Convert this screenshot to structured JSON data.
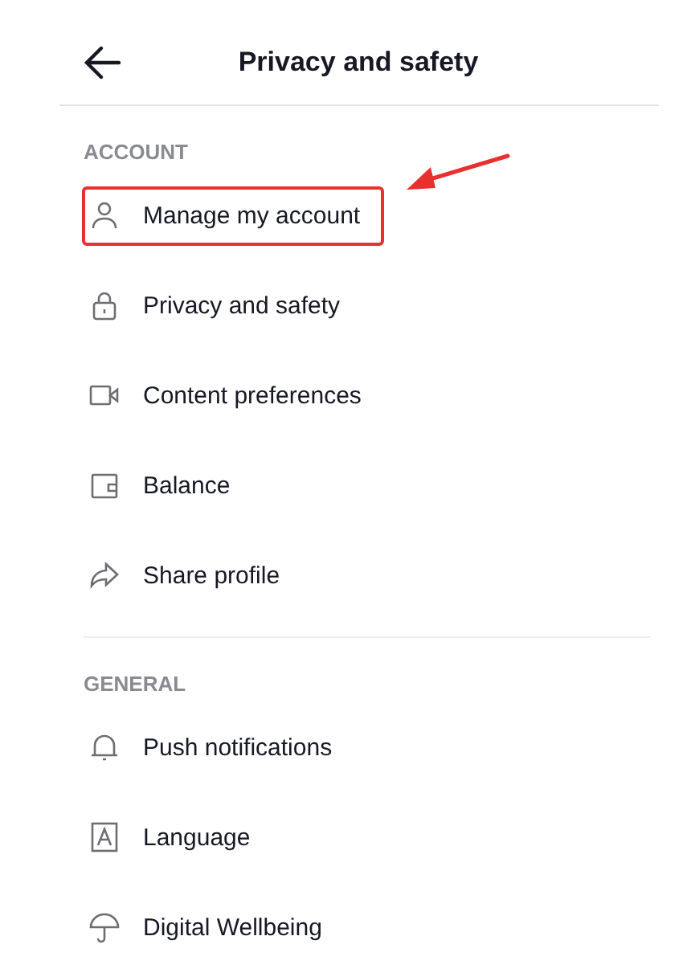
{
  "header": {
    "title": "Privacy and safety"
  },
  "sections": [
    {
      "heading": "ACCOUNT",
      "items": [
        {
          "label": "Manage my account",
          "highlighted": true
        },
        {
          "label": "Privacy and safety",
          "highlighted": false
        },
        {
          "label": "Content preferences",
          "highlighted": false
        },
        {
          "label": "Balance",
          "highlighted": false
        },
        {
          "label": "Share profile",
          "highlighted": false
        }
      ]
    },
    {
      "heading": "GENERAL",
      "items": [
        {
          "label": "Push notifications",
          "highlighted": false
        },
        {
          "label": "Language",
          "highlighted": false
        },
        {
          "label": "Digital Wellbeing",
          "highlighted": false
        }
      ]
    }
  ]
}
